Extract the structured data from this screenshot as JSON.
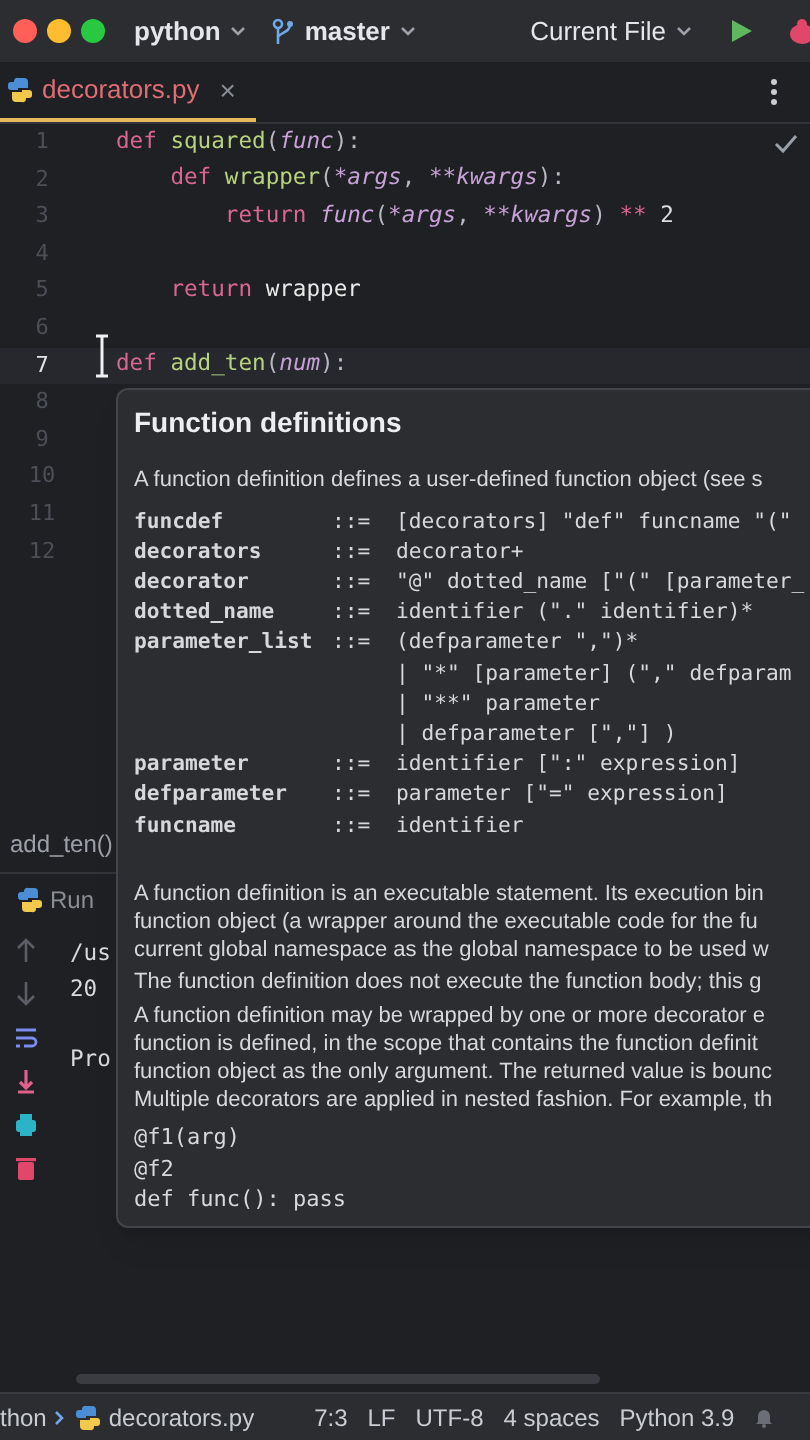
{
  "title_bar": {
    "project": "python",
    "branch": "master",
    "run_config": "Current File"
  },
  "tabs": [
    {
      "label": "decorators.py",
      "selected": true,
      "close": "×"
    }
  ],
  "editor": {
    "lines": [
      {
        "number": "1",
        "current": false,
        "tokens": [
          {
            "kind": "keyword",
            "text": "def"
          },
          {
            "kind": "function",
            "text": " squared"
          },
          {
            "kind": "punct",
            "text": "("
          },
          {
            "kind": "param",
            "text": "func"
          },
          {
            "kind": "punct",
            "text": "):"
          }
        ]
      },
      {
        "number": "2",
        "current": false,
        "tokens": [
          {
            "kind": "keyword",
            "text": "    def"
          },
          {
            "kind": "function",
            "text": " wrapper"
          },
          {
            "kind": "punct",
            "text": "("
          },
          {
            "kind": "param",
            "text": "*args"
          },
          {
            "kind": "punct",
            "text": ", "
          },
          {
            "kind": "param",
            "text": "**kwargs"
          },
          {
            "kind": "punct",
            "text": "):"
          }
        ]
      },
      {
        "number": "3",
        "current": false,
        "tokens": [
          {
            "kind": "keyword",
            "text": "        return"
          },
          {
            "kind": "param",
            "text": " func"
          },
          {
            "kind": "punct",
            "text": "("
          },
          {
            "kind": "param",
            "text": "*args"
          },
          {
            "kind": "punct",
            "text": ", "
          },
          {
            "kind": "param",
            "text": "**kwargs"
          },
          {
            "kind": "punct",
            "text": ")"
          },
          {
            "kind": "operator",
            "text": " **"
          },
          {
            "kind": "number",
            "text": " 2"
          }
        ]
      },
      {
        "number": "4",
        "current": false
      },
      {
        "number": "5",
        "current": false,
        "tokens": [
          {
            "kind": "keyword",
            "text": "    return"
          },
          {
            "kind": "plain",
            "text": " wrapper"
          }
        ]
      },
      {
        "number": "6",
        "current": false
      },
      {
        "number": "7",
        "current": true,
        "tokens": [
          {
            "kind": "keyword",
            "text": "def"
          },
          {
            "kind": "function",
            "text": " add_ten"
          },
          {
            "kind": "punct",
            "text": "("
          },
          {
            "kind": "param",
            "text": "num"
          },
          {
            "kind": "punct",
            "text": "):"
          }
        ]
      },
      {
        "number": "8",
        "current": false
      },
      {
        "number": "9",
        "current": false
      },
      {
        "number": "10",
        "current": false
      },
      {
        "number": "11",
        "current": false
      },
      {
        "number": "12",
        "current": false
      }
    ],
    "breadcrumb": "add_ten()"
  },
  "doc_popup": {
    "title": "Function definitions",
    "intro": "A function definition defines a user-defined function object (see s",
    "grammar": [
      {
        "name": "funcdef",
        "op": "::=",
        "rule": "[decorators] \"def\" funcname \"(\""
      },
      {
        "name": "decorators",
        "op": "::=",
        "rule": "decorator+"
      },
      {
        "name": "decorator",
        "op": "::=",
        "rule": "\"@\" dotted_name [\"(\" [parameter_"
      },
      {
        "name": "dotted_name",
        "op": "::=",
        "rule": "identifier (\".\" identifier)*"
      },
      {
        "name": "parameter_list",
        "op": "::=",
        "rule": "(defparameter \",\")*"
      },
      {
        "rule": "| \"*\" [parameter] (\",\" defparam"
      },
      {
        "rule": "| \"**\" parameter"
      },
      {
        "rule": "| defparameter [\",\"] )"
      },
      {
        "name": "parameter",
        "op": "::=",
        "rule": "identifier [\":\" expression]"
      },
      {
        "name": "defparameter",
        "op": "::=",
        "rule": "parameter [\"=\" expression]"
      },
      {
        "name": "funcname",
        "op": "::=",
        "rule": "identifier"
      }
    ],
    "paragraphs": [
      [
        "A function definition is an executable statement. Its execution bin",
        "function object (a wrapper around the executable code for the fu",
        "current global namespace as the global namespace to be used w"
      ],
      [
        "The function definition does not execute the function body; this g"
      ],
      [
        "A function definition may be wrapped by one or more decorator e",
        "function is defined, in the scope that contains the function definit",
        "function object as the only argument. The returned value is bounc",
        "Multiple decorators are applied in nested fashion. For example, th"
      ]
    ],
    "example": [
      "@f1(arg)",
      "@f2",
      "def func(): pass"
    ]
  },
  "run_panel": {
    "title": "Run",
    "console": [
      "/us",
      "20",
      "Pro"
    ]
  },
  "status_bar": {
    "path": "thon",
    "file": "decorators.py",
    "position": "7:3",
    "line_ending": "LF",
    "encoding": "UTF-8",
    "indent": "4 spaces",
    "interpreter": "Python 3.9"
  }
}
